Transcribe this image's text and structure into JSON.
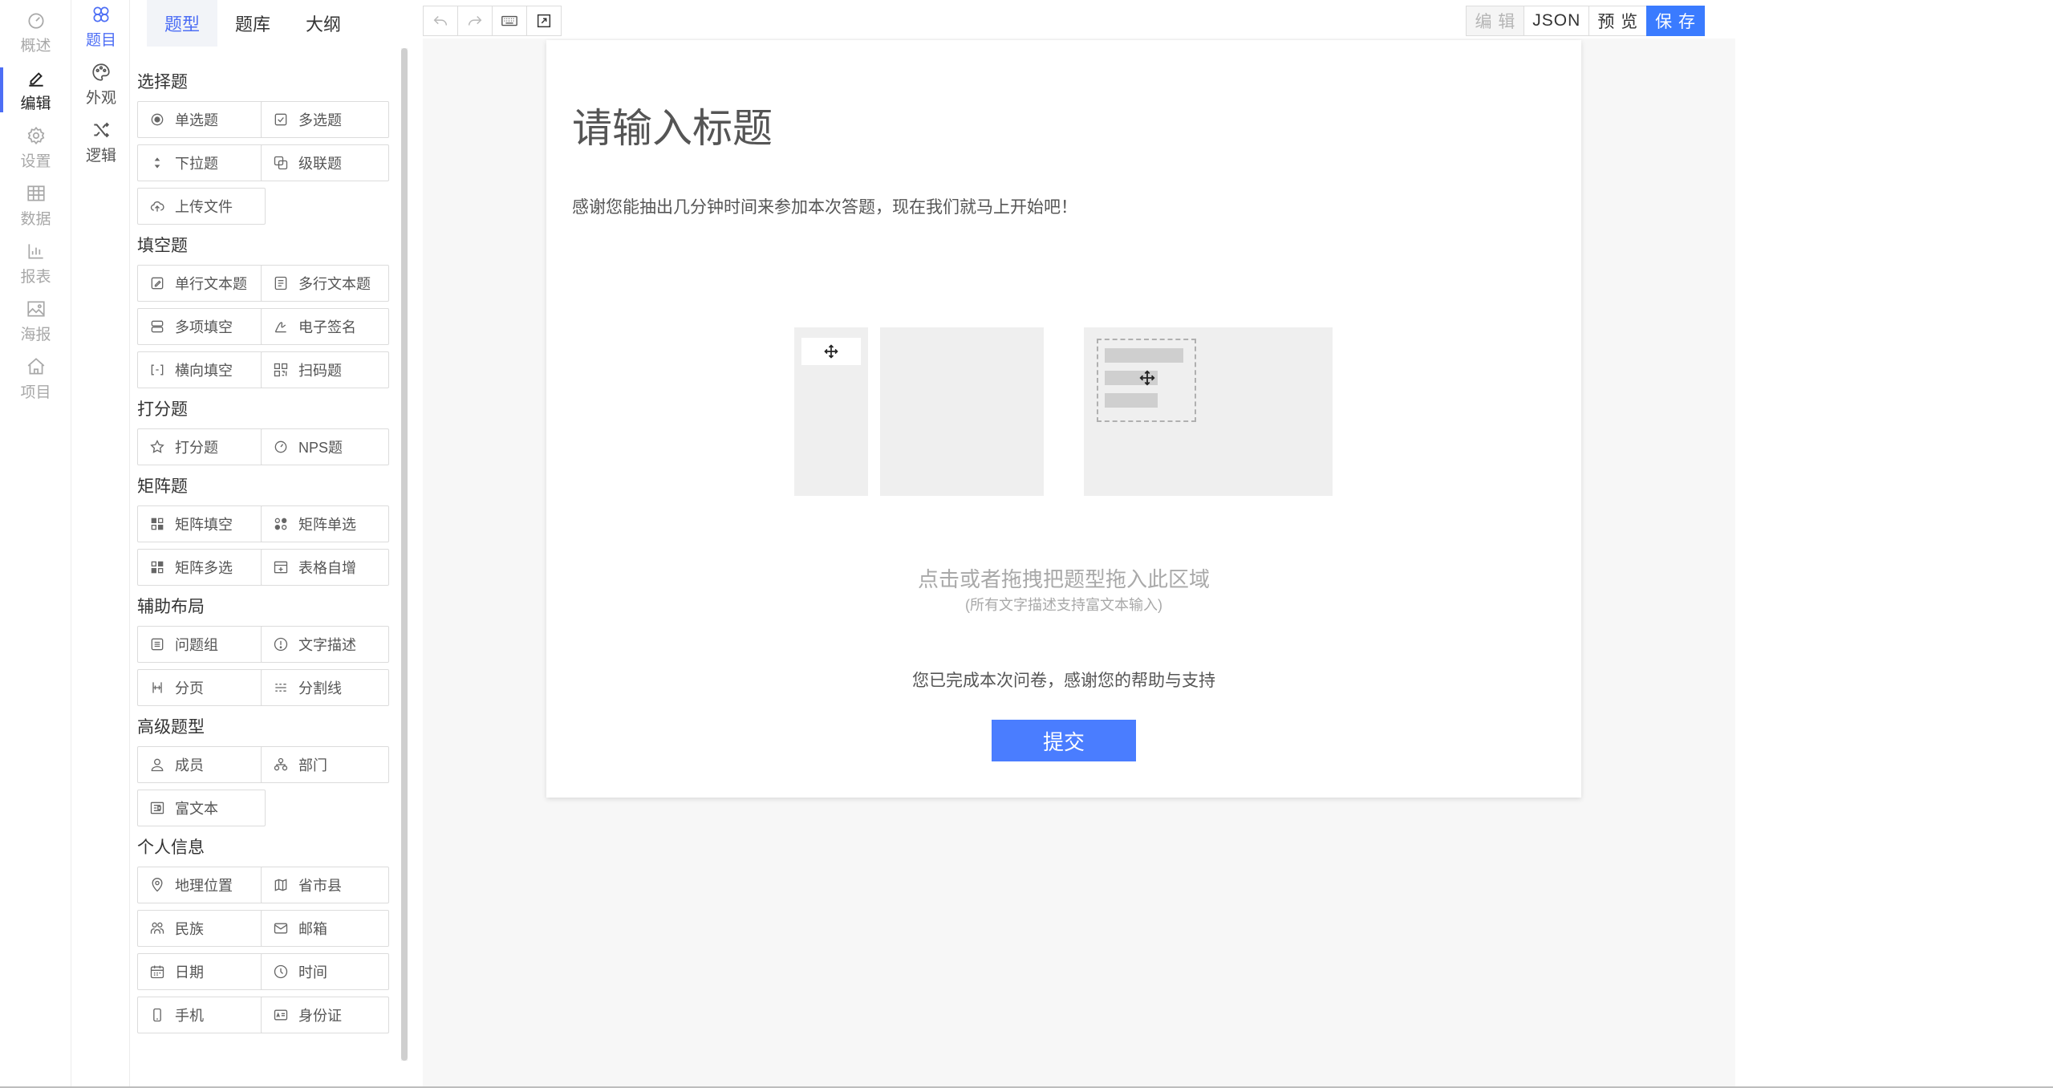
{
  "nav_primary": [
    {
      "label": "概述",
      "icon": "dashboard-icon"
    },
    {
      "label": "编辑",
      "icon": "pen-icon",
      "active": true
    },
    {
      "label": "设置",
      "icon": "gear-icon"
    },
    {
      "label": "数据",
      "icon": "table-icon"
    },
    {
      "label": "报表",
      "icon": "bar-chart-icon"
    },
    {
      "label": "海报",
      "icon": "image-icon"
    },
    {
      "label": "项目",
      "icon": "home-icon"
    }
  ],
  "nav_secondary": [
    {
      "label": "题目",
      "icon": "clover-icon",
      "active": true
    },
    {
      "label": "外观",
      "icon": "palette-icon"
    },
    {
      "label": "逻辑",
      "icon": "shuffle-icon"
    }
  ],
  "panel": {
    "tabs": [
      {
        "label": "题型",
        "active": true
      },
      {
        "label": "题库"
      },
      {
        "label": "大纲"
      }
    ],
    "sections": [
      {
        "title": "选择题",
        "items": [
          {
            "label": "单选题",
            "icon": "radio-icon"
          },
          {
            "label": "多选题",
            "icon": "checkbox-icon"
          },
          {
            "label": "下拉题",
            "icon": "sort-icon"
          },
          {
            "label": "级联题",
            "icon": "cascade-icon"
          },
          {
            "label": "上传文件",
            "icon": "cloud-upload-icon"
          }
        ]
      },
      {
        "title": "填空题",
        "items": [
          {
            "label": "单行文本题",
            "icon": "edit-icon"
          },
          {
            "label": "多行文本题",
            "icon": "document-icon"
          },
          {
            "label": "多项填空",
            "icon": "rows-icon"
          },
          {
            "label": "电子签名",
            "icon": "signature-icon"
          },
          {
            "label": "横向填空",
            "icon": "bracket-icon"
          },
          {
            "label": "扫码题",
            "icon": "qrcode-icon"
          }
        ]
      },
      {
        "title": "打分题",
        "items": [
          {
            "label": "打分题",
            "icon": "star-icon"
          },
          {
            "label": "NPS题",
            "icon": "gauge-icon"
          }
        ]
      },
      {
        "title": "矩阵题",
        "items": [
          {
            "label": "矩阵填空",
            "icon": "matrix-fill-icon"
          },
          {
            "label": "矩阵单选",
            "icon": "matrix-radio-icon"
          },
          {
            "label": "矩阵多选",
            "icon": "matrix-check-icon"
          },
          {
            "label": "表格自增",
            "icon": "table-add-icon"
          }
        ]
      },
      {
        "title": "辅助布局",
        "items": [
          {
            "label": "问题组",
            "icon": "group-icon"
          },
          {
            "label": "文字描述",
            "icon": "alert-icon"
          },
          {
            "label": "分页",
            "icon": "page-break-icon"
          },
          {
            "label": "分割线",
            "icon": "divider-icon"
          }
        ]
      },
      {
        "title": "高级题型",
        "items": [
          {
            "label": "成员",
            "icon": "user-icon"
          },
          {
            "label": "部门",
            "icon": "org-icon"
          },
          {
            "label": "富文本",
            "icon": "rich-text-icon"
          }
        ]
      },
      {
        "title": "个人信息",
        "items": [
          {
            "label": "地理位置",
            "icon": "location-icon"
          },
          {
            "label": "省市县",
            "icon": "map-icon"
          },
          {
            "label": "民族",
            "icon": "people-icon"
          },
          {
            "label": "邮箱",
            "icon": "mail-icon"
          },
          {
            "label": "日期",
            "icon": "calendar-icon"
          },
          {
            "label": "时间",
            "icon": "clock-icon"
          },
          {
            "label": "手机",
            "icon": "phone-icon"
          },
          {
            "label": "身份证",
            "icon": "id-card-icon"
          }
        ]
      }
    ]
  },
  "toolbar": {
    "left_icons": [
      "undo-icon",
      "redo-icon",
      "keyboard-icon",
      "export-icon"
    ],
    "edit_label": "编 辑",
    "json_label": "JSON",
    "preview_label": "预 览",
    "save_label": "保 存"
  },
  "form": {
    "title": "请输入标题",
    "description": "感谢您能抽出几分钟时间来参加本次答题，现在我们就马上开始吧！",
    "drop_hint": "点击或者拖拽把题型拖入此区域",
    "drop_hint_sub": "(所有文字描述支持富文本输入)",
    "finish_text": "您已完成本次问卷，感谢您的帮助与支持",
    "submit_label": "提交"
  },
  "colors": {
    "accent": "#4d6ef5",
    "primary_button": "#3a7bff",
    "submit_button": "#4a7dff"
  }
}
